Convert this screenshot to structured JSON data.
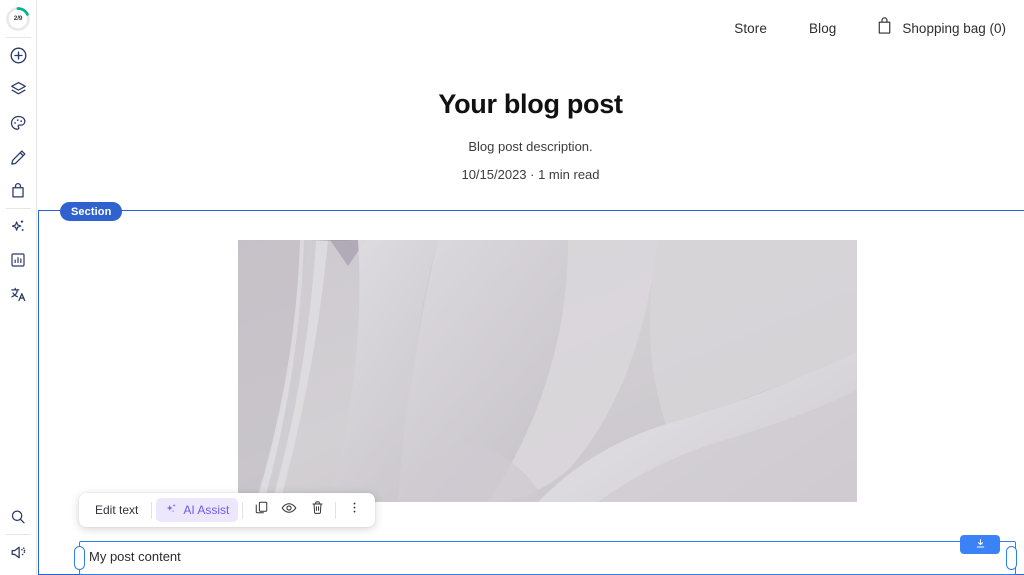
{
  "sidebar": {
    "progress": {
      "label": "2/9",
      "value": 2,
      "total": 9,
      "color": "#00b58e"
    },
    "items": [
      {
        "name": "add-elements",
        "icon": "plus-circle-icon"
      },
      {
        "name": "pages-layers",
        "icon": "layers-icon"
      },
      {
        "name": "design-theme",
        "icon": "palette-icon"
      },
      {
        "name": "edit-draw",
        "icon": "pencil-icon"
      },
      {
        "name": "store",
        "icon": "shopping-bag-icon"
      },
      {
        "name": "ai-assistant",
        "icon": "sparkle-icon"
      },
      {
        "name": "analytics",
        "icon": "chart-icon"
      },
      {
        "name": "translate",
        "icon": "translate-icon"
      }
    ],
    "bottom_items": [
      {
        "name": "search",
        "icon": "search-icon"
      },
      {
        "name": "announcements",
        "icon": "megaphone-icon"
      }
    ]
  },
  "topnav": {
    "links": [
      {
        "label": "Store"
      },
      {
        "label": "Blog"
      }
    ],
    "bag": {
      "icon": "shopping-bag-icon",
      "label": "Shopping bag (0)"
    }
  },
  "hero": {
    "title": "Your blog post",
    "description": "Blog post description.",
    "meta": "10/15/2023 · 1 min read"
  },
  "selection": {
    "badge": "Section",
    "border_color": "#2563d9",
    "badge_color": "#2f62cf"
  },
  "toolbar": {
    "edit_text_label": "Edit text",
    "ai_assist_label": "AI Assist",
    "ai_bg": "#ece7fd",
    "ai_fg": "#7558ef",
    "actions": [
      {
        "name": "duplicate",
        "icon": "duplicate-icon"
      },
      {
        "name": "hide",
        "icon": "eye-icon"
      },
      {
        "name": "delete",
        "icon": "trash-icon"
      },
      {
        "name": "more-options",
        "icon": "more-vertical-icon"
      }
    ]
  },
  "text_element": {
    "value": "My post content",
    "border_color": "#2f80ed",
    "download_icon": "download-icon"
  }
}
